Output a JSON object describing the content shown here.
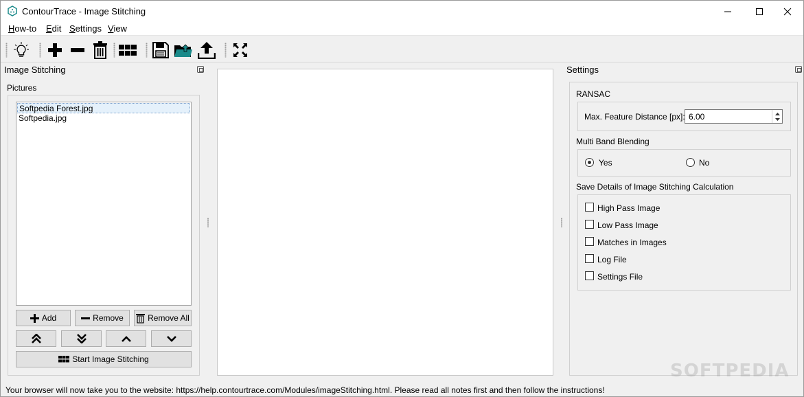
{
  "window": {
    "title": "ContourTrace - Image Stitching"
  },
  "menu": [
    {
      "label": "How-to",
      "accel": "H",
      "rest": "ow-to"
    },
    {
      "label": "Edit",
      "accel": "E",
      "rest": "dit"
    },
    {
      "label": "Settings",
      "accel": "S",
      "rest": "ettings"
    },
    {
      "label": "View",
      "accel": "V",
      "rest": "iew"
    }
  ],
  "toolbar": {
    "icons": [
      "lightbulb-icon",
      "plus-icon",
      "minus-icon",
      "trash-icon",
      "stitch-grid-icon",
      "save-icon",
      "open-folder-icon",
      "upload-icon",
      "fullscreen-icon"
    ]
  },
  "left_dock": {
    "title": "Image Stitching",
    "pictures_label": "Pictures",
    "pictures": [
      "Softpedia Forest.jpg",
      "Softpedia.jpg"
    ],
    "selected_index": 0,
    "buttons": {
      "add": "Add",
      "remove": "Remove",
      "remove_all": "Remove All",
      "start": "Start Image Stitching"
    }
  },
  "right_dock": {
    "title": "Settings",
    "ransac": {
      "label": "RANSAC",
      "field_label": "Max. Feature Distance [px]:",
      "field_value": "6.00"
    },
    "blending": {
      "label": "Multi Band Blending",
      "options": [
        "Yes",
        "No"
      ],
      "selected": "Yes"
    },
    "save_details": {
      "label": "Save Details of Image Stitching Calculation",
      "options": [
        {
          "label": "High Pass Image",
          "checked": false
        },
        {
          "label": "Low Pass Image",
          "checked": false
        },
        {
          "label": "Matches in Images",
          "checked": false
        },
        {
          "label": "Log File",
          "checked": false
        },
        {
          "label": "Settings File",
          "checked": false
        }
      ]
    }
  },
  "status": {
    "text": "Your browser will now take you to the website:  https://help.contourtrace.com/Modules/imageStitching.html. Please read all notes first and then follow the instructions!"
  },
  "watermark": "SOFTPEDIA",
  "colors": {
    "accent_icon": "#1a8a8a",
    "selection_bg": "#e5f1fb"
  }
}
